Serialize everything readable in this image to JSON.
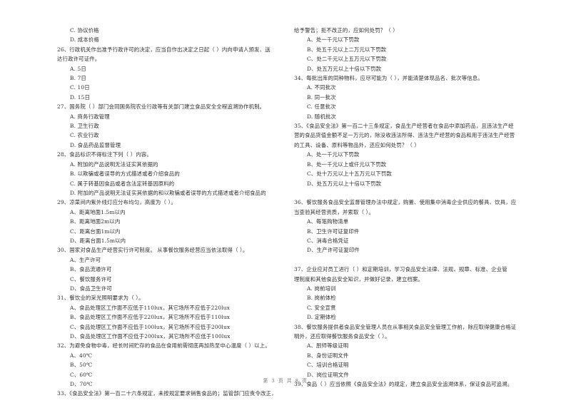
{
  "document": {
    "page_footer": "第 3 页 共 8 页",
    "page_number": "3",
    "total_pages": "8"
  },
  "left_column": {
    "orphan_options": [
      "C. 协议价格",
      "D. 成本价格"
    ],
    "questions": [
      {
        "number": "26、",
        "stem_lines": [
          "26、行政机关作出准予行政许可的决定，应当自作出决定之日起（     ）内向申请人颁发、送",
          "达行政许可证件。"
        ],
        "options": [
          "A. 5日",
          "B. 7日",
          "C. 10日",
          "D. 15日"
        ]
      },
      {
        "number": "27、",
        "stem_lines": [
          "27、国务院（     ）部门会同国务院农业行政等有关部门建立食品安全全程追溯协作机制。"
        ],
        "options": [
          "A. 商务行政管理",
          "B. 卫生行政",
          "C. 农业行政",
          "D. 食品药品监督管理"
        ]
      },
      {
        "number": "28、",
        "stem_lines": [
          "28、食品标识不得标注下列（     ）内容。"
        ],
        "options": [
          "A. 附加的产品说明无法证实其依据的",
          "B. 以欺骗或者误导的方式描述或者介绍食品的",
          "C. 属于转基因食品或者含法定转基因原料的",
          "D. 附加的产品说明无法证实其依据的和以欺骗或者误导的方式描述或者介绍食品的"
        ]
      },
      {
        "number": "29、",
        "stem_lines": [
          "29、凉菜间内紫外线灯应分布均匀，高度为（     ）。"
        ],
        "options": [
          "A、距离地面1.5m以内",
          "B、距离地面2m以内",
          "C、距离台面1m以内",
          "D、距离台面1.5m以内"
        ]
      },
      {
        "number": "30、",
        "stem_lines": [
          "30、国家对食品生产经营实行许可制度。 从事餐饮服务经营应当依法取得（     ）。"
        ],
        "options": [
          "A、生产许可",
          "B、食品流通许可",
          "C、餐饮服务许可",
          "D、食品卫生许可"
        ]
      },
      {
        "number": "31、",
        "stem_lines": [
          "31、餐饮业的采光照明要求为（     ）。"
        ],
        "options": [
          "A、食品处理区工作面不应低于110lux，其它场所不应低于220lux",
          "B、食品处理区工作面不应低于220lux，其它场所不应低于110lux",
          "C、食品处理区工作面不应低于100lux，其它场所不应低于200lux",
          "D、食品处理区工作面不应低于200lux，其它场所不应低于100lux"
        ]
      },
      {
        "number": "32、",
        "stem_lines": [
          "32、为避免食物中毒，经长时间贮存的食品在食用前需彻底再加热至中心温度（     ）以上。"
        ],
        "options": [
          "A、40℃",
          "B、50℃",
          "C、60℃",
          "D、70℃"
        ]
      },
      {
        "number": "33、",
        "stem_lines": [
          "33、《食品安全法》第一百二十六条规定，未按规定要求销售食品的；监管部门应责令改正，"
        ],
        "options": []
      }
    ]
  },
  "right_column": {
    "continued_stem": "给予警告；拒不改正的，应如何处罚？（     ）",
    "continued_options": [
      "A、处一千元以下罚款",
      "B、处五千元以上二万元以下罚款",
      "C、处二千元以上五万元以下罚款",
      "D、处五万元以上十倍以下罚款"
    ],
    "questions": [
      {
        "number": "34、",
        "stem_lines": [
          "34、每批出库的同种物料，应尽可能为（     ），并能清楚体现品名、批次等信息。"
        ],
        "options": [
          "A. 不同批次",
          "B. 同一批次",
          "C. 任意批次",
          "D. 随机批次"
        ]
      },
      {
        "number": "35、",
        "stem_lines": [
          "35、《食品安全法》第一百二十三条规定，食品生产经营者在食品中添加药品，且违法生产经",
          "营的食品货值金额不足一万元的，除没收违法所得、违法生产经营的食品和用于违法生产经营",
          "的工具、设备、原料等物品外，还应如何处罚？（   ）"
        ],
        "options": [
          "A、处一千元以下罚款",
          "B、处一千元以上或仟元以下罚款",
          "C、处十万元以上十五万元以下罚款",
          "D、处五万元以上十倍以下罚款"
        ]
      },
      {
        "number": "36、",
        "stem_lines": [
          "36、餐饮服务食品安全监督管理办法中规定，购置、使用集中消毒企业供应的餐具、饮具，应",
          "当查验其经营资质，并索取（     ）。"
        ],
        "options": [
          "A、每笔购物清单",
          "B、卫生许可证复印件",
          "C、消毒合格凭证",
          "D、生产许可证复印件"
        ]
      },
      {
        "number": "37、",
        "stem_lines": [
          "37、企业应对员工进行（     ）和定期培训，学习食品安全法律、法规、规章、标准、企业管",
          "理制度和其他食品安全知识，并做好记录，建立档案。"
        ],
        "options": [
          "A. 岗前培训",
          "B. 岗前体检",
          "C. 安全宣贯",
          "D. 定期体检"
        ]
      },
      {
        "number": "38、",
        "stem_lines": [
          "38、餐饮服务提供者食品安全管理人员在从事相关食品安全管理工作前，除应取得健康合格证",
          "明外，还应取得餐饮服务食品安全（     ）。"
        ],
        "options": [
          "A、厨师等级证明",
          "B、身份证明文件",
          "C、培训合格证明",
          "D、岗位证明文件"
        ]
      },
      {
        "number": "39、",
        "stem_lines": [
          "39、食品（     ）应当依照《食品安全法》的规定，建立食品安全追溯体系，保证食品可追溯。"
        ],
        "options": []
      }
    ]
  }
}
